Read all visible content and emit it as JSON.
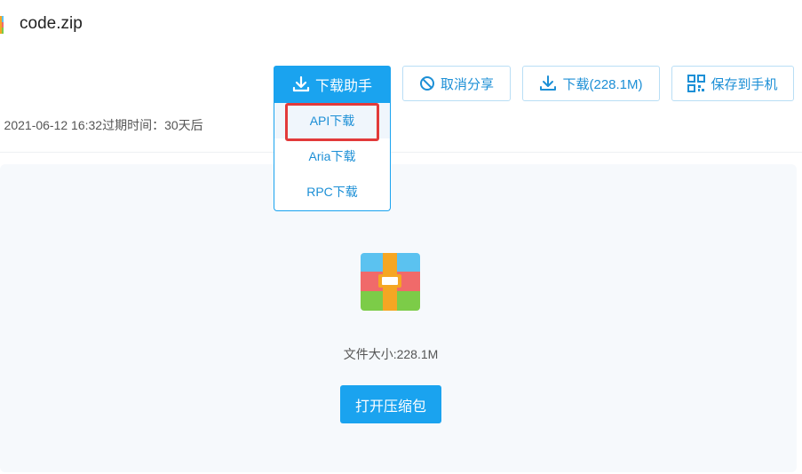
{
  "header": {
    "file_name": "code.zip",
    "file_icon": "zip-archive-icon"
  },
  "toolbar": {
    "helper_label": "下载助手",
    "cancel_share_label": "取消分享",
    "download_label": "下载(228.1M)",
    "save_to_phone_label": "保存到手机"
  },
  "dropdown": {
    "items": [
      {
        "label": "API下载"
      },
      {
        "label": "Aria下载"
      },
      {
        "label": "RPC下载"
      }
    ]
  },
  "meta": {
    "text": ") 2021-06-12 16:32过期时间：30天后"
  },
  "content": {
    "size_label": "文件大小:",
    "size_value": "228.1M",
    "open_button_label": "打开压缩包"
  },
  "colors": {
    "primary": "#1aa3ef",
    "highlight": "#e23a3a",
    "panel_bg": "#f6f9fc"
  }
}
